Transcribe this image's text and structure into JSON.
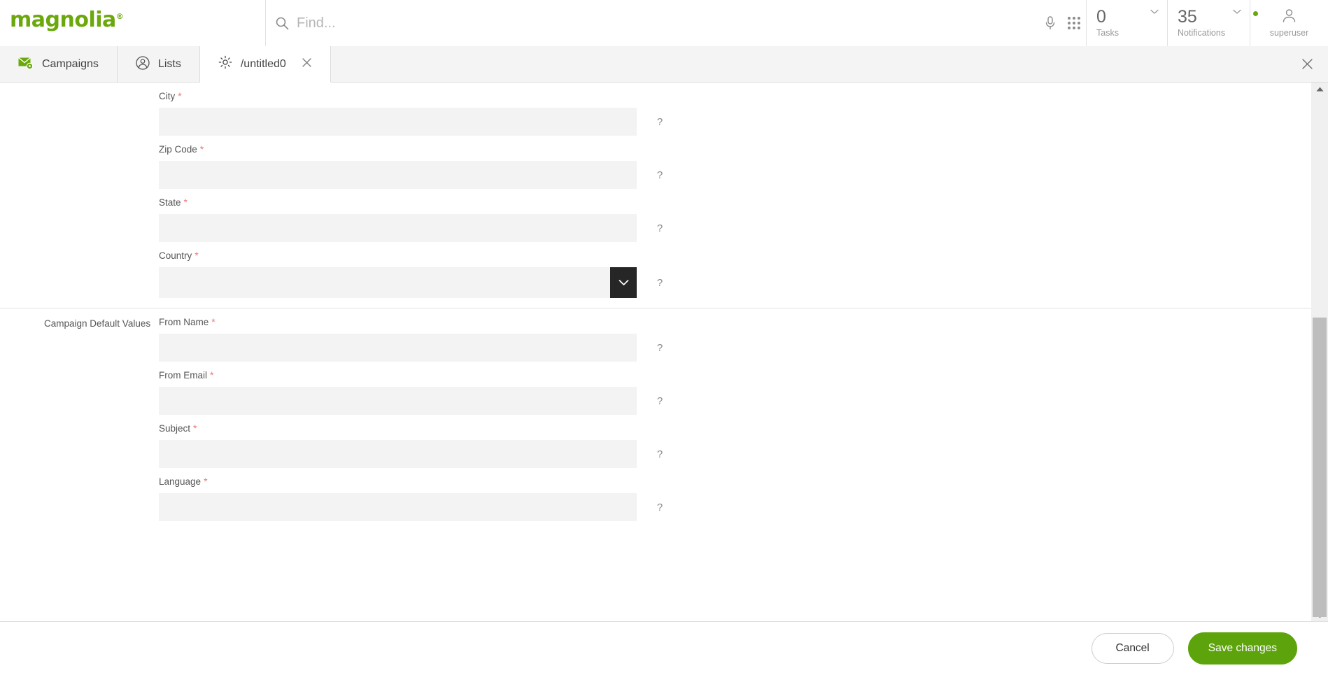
{
  "brand": {
    "name": "magnolia",
    "registered": "®",
    "color": "#6aa80b"
  },
  "search": {
    "placeholder": "Find...",
    "value": "",
    "icon": "search-icon"
  },
  "topbar": {
    "mic_icon": "microphone-icon",
    "apps_icon": "apps-grid-icon",
    "tasks": {
      "count": "0",
      "label": "Tasks"
    },
    "notifications": {
      "count": "35",
      "label": "Notifications",
      "has_dot": true,
      "dot_color": "#6aa80b"
    },
    "user": {
      "label": "superuser",
      "icon": "user-avatar-icon"
    }
  },
  "tabs": [
    {
      "label": "Campaigns",
      "icon": "mail-gear-icon",
      "active": false,
      "closable": false
    },
    {
      "label": "Lists",
      "icon": "user-circle-icon",
      "active": false,
      "closable": false
    },
    {
      "label": "/untitled0",
      "icon": "gear-icon",
      "active": true,
      "closable": true
    }
  ],
  "tabbar": {
    "close_all_icon": "close-icon"
  },
  "form": {
    "sections": [
      {
        "label": "",
        "fields": [
          {
            "label": "City",
            "required": true,
            "value": "",
            "type": "text",
            "help": "?"
          },
          {
            "label": "Zip Code",
            "required": true,
            "value": "",
            "type": "text",
            "help": "?"
          },
          {
            "label": "State",
            "required": true,
            "value": "",
            "type": "text",
            "help": "?"
          },
          {
            "label": "Country",
            "required": true,
            "value": "",
            "type": "select",
            "help": "?"
          }
        ]
      },
      {
        "label": "Campaign Default Values",
        "fields": [
          {
            "label": "From Name",
            "required": true,
            "value": "",
            "type": "text",
            "help": "?"
          },
          {
            "label": "From Email",
            "required": true,
            "value": "",
            "type": "text",
            "help": "?"
          },
          {
            "label": "Subject",
            "required": true,
            "value": "",
            "type": "text",
            "help": "?"
          },
          {
            "label": "Language",
            "required": true,
            "value": "",
            "type": "text",
            "help": "?"
          }
        ]
      }
    ],
    "required_marker": "*"
  },
  "footer": {
    "cancel_label": "Cancel",
    "save_label": "Save changes",
    "save_color": "#5da40c"
  },
  "scrollbar": {
    "up_icon": "scroll-up-arrow",
    "down_icon": "scroll-down-arrow"
  }
}
